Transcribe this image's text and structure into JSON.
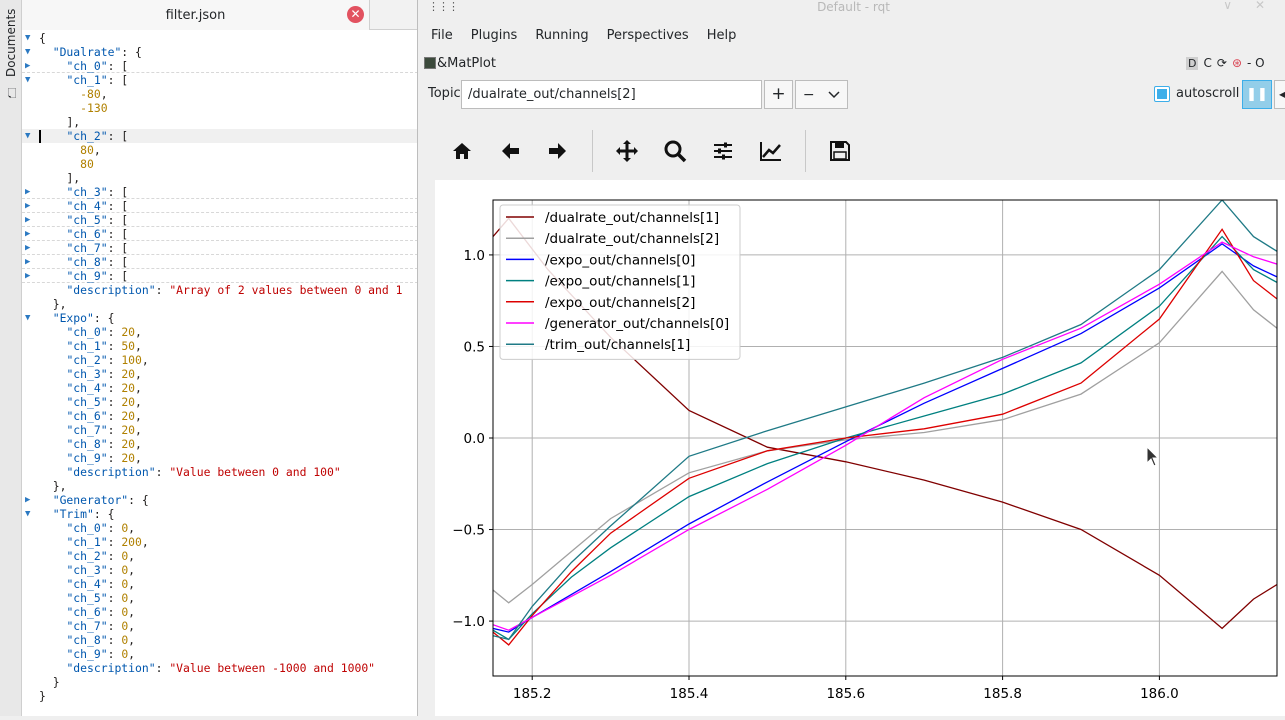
{
  "dock": {
    "label": "Documents"
  },
  "editor": {
    "tab_title": "filter.json",
    "lines": [
      {
        "fold": "open",
        "html": "<span class='p'>{</span>"
      },
      {
        "fold": "open",
        "html": "  <span class='k'>\"Dualrate\"</span><span class='p'>: {</span>"
      },
      {
        "fold": "closed",
        "html": "    <span class='k'>\"ch_0\"</span><span class='p'>: [</span>",
        "folded": true
      },
      {
        "fold": "open",
        "html": "    <span class='k'>\"ch_1\"</span><span class='p'>: [</span>"
      },
      {
        "fold": "",
        "html": "      <span class='n'>-80</span><span class='p'>,</span>"
      },
      {
        "fold": "",
        "html": "      <span class='n'>-130</span>"
      },
      {
        "fold": "",
        "html": "    <span class='p'>],</span>"
      },
      {
        "fold": "open",
        "html": "    <span class='k'>\"ch_2\"</span><span class='p'>: [</span>",
        "current": true
      },
      {
        "fold": "",
        "html": "      <span class='n'>80</span><span class='p'>,</span>"
      },
      {
        "fold": "",
        "html": "      <span class='n'>80</span>"
      },
      {
        "fold": "",
        "html": "    <span class='p'>],</span>"
      },
      {
        "fold": "closed",
        "html": "    <span class='k'>\"ch_3\"</span><span class='p'>: [</span>",
        "folded": true
      },
      {
        "fold": "closed",
        "html": "    <span class='k'>\"ch_4\"</span><span class='p'>: [</span>",
        "folded": true
      },
      {
        "fold": "closed",
        "html": "    <span class='k'>\"ch_5\"</span><span class='p'>: [</span>",
        "folded": true
      },
      {
        "fold": "closed",
        "html": "    <span class='k'>\"ch_6\"</span><span class='p'>: [</span>",
        "folded": true
      },
      {
        "fold": "closed",
        "html": "    <span class='k'>\"ch_7\"</span><span class='p'>: [</span>",
        "folded": true
      },
      {
        "fold": "closed",
        "html": "    <span class='k'>\"ch_8\"</span><span class='p'>: [</span>",
        "folded": true
      },
      {
        "fold": "closed",
        "html": "    <span class='k'>\"ch_9\"</span><span class='p'>: [</span>",
        "folded": true
      },
      {
        "fold": "",
        "html": "    <span class='k'>\"description\"</span><span class='p'>: </span><span class='s'>\"Array of 2 values between 0 and 1</span>"
      },
      {
        "fold": "",
        "html": "  <span class='p'>},</span>"
      },
      {
        "fold": "open",
        "html": "  <span class='k'>\"Expo\"</span><span class='p'>: {</span>"
      },
      {
        "fold": "",
        "html": "    <span class='k'>\"ch_0\"</span><span class='p'>: </span><span class='n'>20</span><span class='p'>,</span>"
      },
      {
        "fold": "",
        "html": "    <span class='k'>\"ch_1\"</span><span class='p'>: </span><span class='n'>50</span><span class='p'>,</span>"
      },
      {
        "fold": "",
        "html": "    <span class='k'>\"ch_2\"</span><span class='p'>: </span><span class='n'>100</span><span class='p'>,</span>"
      },
      {
        "fold": "",
        "html": "    <span class='k'>\"ch_3\"</span><span class='p'>: </span><span class='n'>20</span><span class='p'>,</span>"
      },
      {
        "fold": "",
        "html": "    <span class='k'>\"ch_4\"</span><span class='p'>: </span><span class='n'>20</span><span class='p'>,</span>"
      },
      {
        "fold": "",
        "html": "    <span class='k'>\"ch_5\"</span><span class='p'>: </span><span class='n'>20</span><span class='p'>,</span>"
      },
      {
        "fold": "",
        "html": "    <span class='k'>\"ch_6\"</span><span class='p'>: </span><span class='n'>20</span><span class='p'>,</span>"
      },
      {
        "fold": "",
        "html": "    <span class='k'>\"ch_7\"</span><span class='p'>: </span><span class='n'>20</span><span class='p'>,</span>"
      },
      {
        "fold": "",
        "html": "    <span class='k'>\"ch_8\"</span><span class='p'>: </span><span class='n'>20</span><span class='p'>,</span>"
      },
      {
        "fold": "",
        "html": "    <span class='k'>\"ch_9\"</span><span class='p'>: </span><span class='n'>20</span><span class='p'>,</span>"
      },
      {
        "fold": "",
        "html": "    <span class='k'>\"description\"</span><span class='p'>: </span><span class='s'>\"Value between 0 and 100\"</span>"
      },
      {
        "fold": "",
        "html": "  <span class='p'>},</span>"
      },
      {
        "fold": "closed",
        "html": "  <span class='k'>\"Generator\"</span><span class='p'>: {</span>"
      },
      {
        "fold": "open",
        "html": "  <span class='k'>\"Trim\"</span><span class='p'>: {</span>"
      },
      {
        "fold": "",
        "html": "    <span class='k'>\"ch_0\"</span><span class='p'>: </span><span class='n'>0</span><span class='p'>,</span>"
      },
      {
        "fold": "",
        "html": "    <span class='k'>\"ch_1\"</span><span class='p'>: </span><span class='n'>200</span><span class='p'>,</span>"
      },
      {
        "fold": "",
        "html": "    <span class='k'>\"ch_2\"</span><span class='p'>: </span><span class='n'>0</span><span class='p'>,</span>"
      },
      {
        "fold": "",
        "html": "    <span class='k'>\"ch_3\"</span><span class='p'>: </span><span class='n'>0</span><span class='p'>,</span>"
      },
      {
        "fold": "",
        "html": "    <span class='k'>\"ch_4\"</span><span class='p'>: </span><span class='n'>0</span><span class='p'>,</span>"
      },
      {
        "fold": "",
        "html": "    <span class='k'>\"ch_5\"</span><span class='p'>: </span><span class='n'>0</span><span class='p'>,</span>"
      },
      {
        "fold": "",
        "html": "    <span class='k'>\"ch_6\"</span><span class='p'>: </span><span class='n'>0</span><span class='p'>,</span>"
      },
      {
        "fold": "",
        "html": "    <span class='k'>\"ch_7\"</span><span class='p'>: </span><span class='n'>0</span><span class='p'>,</span>"
      },
      {
        "fold": "",
        "html": "    <span class='k'>\"ch_8\"</span><span class='p'>: </span><span class='n'>0</span><span class='p'>,</span>"
      },
      {
        "fold": "",
        "html": "    <span class='k'>\"ch_9\"</span><span class='p'>: </span><span class='n'>0</span><span class='p'>,</span>"
      },
      {
        "fold": "",
        "html": "    <span class='k'>\"description\"</span><span class='p'>: </span><span class='s'>\"Value between -1000 and 1000\"</span>"
      },
      {
        "fold": "",
        "html": "  <span class='p'>}</span>"
      },
      {
        "fold": "",
        "html": "<span class='p'>}</span>"
      }
    ]
  },
  "rqt": {
    "window_title": "Default - rqt",
    "menu": [
      "File",
      "Plugins",
      "Running",
      "Perspectives",
      "Help"
    ],
    "plugin_title": "&MatPlot",
    "plugin_controls": {
      "d": "D",
      "c": "C",
      "edge": "- O"
    },
    "topic_label": "Topic",
    "topic_value": "/dualrate_out/channels[2]",
    "add_label": "+",
    "remove_label": "−",
    "autoscroll_label": "autoscroll",
    "autoscroll_checked": true
  },
  "toolbar": {
    "buttons": [
      "home-icon",
      "back-arrow-icon",
      "forward-arrow-icon",
      "pan-icon",
      "zoom-icon",
      "subplots-config-icon",
      "edit-curves-icon",
      "save-icon"
    ]
  },
  "chart_data": {
    "type": "line",
    "xlim": [
      185.15,
      186.15
    ],
    "ylim": [
      -1.3,
      1.3
    ],
    "xticks": [
      185.2,
      185.4,
      185.6,
      185.8,
      186.0
    ],
    "xtick_labels": [
      "185.2",
      "185.4",
      "185.6",
      "185.8",
      "186.0"
    ],
    "yticks": [
      -1.0,
      -0.5,
      0.0,
      0.5,
      1.0
    ],
    "ytick_labels": [
      "−1.0",
      "−0.5",
      "0.0",
      "0.5",
      "1.0"
    ],
    "grid": true,
    "legend_position": "top-left",
    "series": [
      {
        "name": "/dualrate_out/channels[1]",
        "color": "#800000",
        "x": [
          185.15,
          185.17,
          185.22,
          185.3,
          185.4,
          185.5,
          185.6,
          185.7,
          185.8,
          185.9,
          186.0,
          186.08,
          186.12,
          186.15
        ],
        "y": [
          1.1,
          1.2,
          0.92,
          0.55,
          0.15,
          -0.05,
          -0.13,
          -0.23,
          -0.35,
          -0.5,
          -0.75,
          -1.04,
          -0.88,
          -0.8
        ]
      },
      {
        "name": "/dualrate_out/channels[2]",
        "color": "#a0a0a0",
        "x": [
          185.15,
          185.17,
          185.2,
          185.25,
          185.3,
          185.4,
          185.5,
          185.6,
          185.7,
          185.8,
          185.9,
          186.0,
          186.08,
          186.12,
          186.15
        ],
        "y": [
          -0.83,
          -0.9,
          -0.8,
          -0.62,
          -0.44,
          -0.19,
          -0.07,
          -0.01,
          0.03,
          0.1,
          0.24,
          0.52,
          0.91,
          0.7,
          0.6
        ]
      },
      {
        "name": "/expo_out/channels[0]",
        "color": "#0000ff",
        "x": [
          185.15,
          185.17,
          185.2,
          185.3,
          185.4,
          185.5,
          185.6,
          185.7,
          185.8,
          185.9,
          186.0,
          186.08,
          186.12,
          186.15
        ],
        "y": [
          -1.04,
          -1.06,
          -0.98,
          -0.73,
          -0.47,
          -0.24,
          -0.02,
          0.19,
          0.38,
          0.57,
          0.82,
          1.06,
          0.94,
          0.88
        ]
      },
      {
        "name": "/expo_out/channels[1]",
        "color": "#008080",
        "x": [
          185.15,
          185.17,
          185.2,
          185.25,
          185.3,
          185.4,
          185.5,
          185.6,
          185.7,
          185.8,
          185.9,
          186.0,
          186.08,
          186.12,
          186.15
        ],
        "y": [
          -1.05,
          -1.1,
          -0.96,
          -0.76,
          -0.6,
          -0.32,
          -0.14,
          0.0,
          0.12,
          0.24,
          0.41,
          0.72,
          1.1,
          0.92,
          0.85
        ]
      },
      {
        "name": "/expo_out/channels[2]",
        "color": "#dd0000",
        "x": [
          185.15,
          185.17,
          185.2,
          185.25,
          185.3,
          185.4,
          185.5,
          185.6,
          185.7,
          185.8,
          185.9,
          186.0,
          186.08,
          186.12,
          186.15
        ],
        "y": [
          -1.06,
          -1.13,
          -0.97,
          -0.73,
          -0.52,
          -0.22,
          -0.07,
          0.0,
          0.05,
          0.13,
          0.3,
          0.65,
          1.14,
          0.86,
          0.76
        ]
      },
      {
        "name": "/generator_out/channels[0]",
        "color": "#ff00ff",
        "x": [
          185.15,
          185.17,
          185.2,
          185.3,
          185.4,
          185.5,
          185.6,
          185.7,
          185.8,
          185.9,
          186.0,
          186.08,
          186.12,
          186.15
        ],
        "y": [
          -1.02,
          -1.05,
          -0.98,
          -0.75,
          -0.5,
          -0.28,
          -0.04,
          0.22,
          0.43,
          0.6,
          0.84,
          1.07,
          0.99,
          0.95
        ]
      },
      {
        "name": "/trim_out/channels[1]",
        "color": "#1f7a86",
        "x": [
          185.15,
          185.17,
          185.2,
          185.25,
          185.3,
          185.4,
          185.5,
          185.6,
          185.7,
          185.8,
          185.9,
          186.0,
          186.08,
          186.12,
          186.15
        ],
        "y": [
          -1.08,
          -1.1,
          -0.92,
          -0.68,
          -0.48,
          -0.1,
          0.04,
          0.17,
          0.3,
          0.44,
          0.62,
          0.92,
          1.3,
          1.1,
          1.02
        ]
      }
    ]
  }
}
